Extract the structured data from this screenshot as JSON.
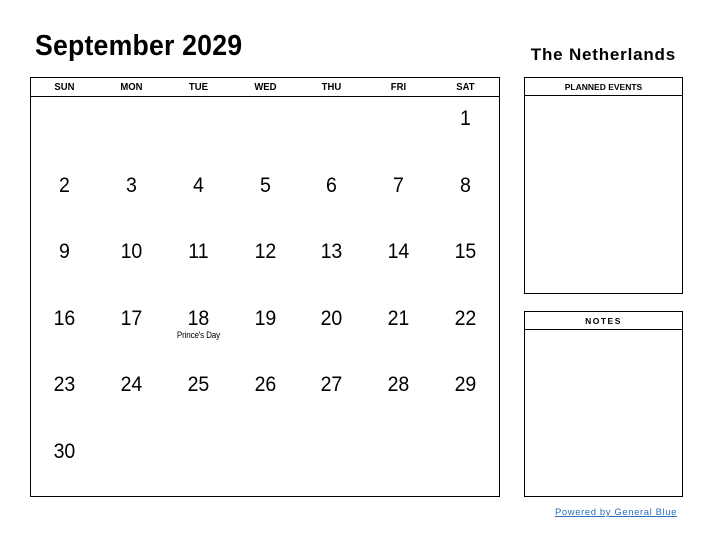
{
  "header": {
    "title": "September 2029",
    "country": "The Netherlands"
  },
  "calendar": {
    "weekdays": [
      "SUN",
      "MON",
      "TUE",
      "WED",
      "THU",
      "FRI",
      "SAT"
    ],
    "weeks": [
      [
        {
          "day": ""
        },
        {
          "day": ""
        },
        {
          "day": ""
        },
        {
          "day": ""
        },
        {
          "day": ""
        },
        {
          "day": ""
        },
        {
          "day": "1"
        }
      ],
      [
        {
          "day": "2"
        },
        {
          "day": "3"
        },
        {
          "day": "4"
        },
        {
          "day": "5"
        },
        {
          "day": "6"
        },
        {
          "day": "7"
        },
        {
          "day": "8"
        }
      ],
      [
        {
          "day": "9"
        },
        {
          "day": "10"
        },
        {
          "day": "11"
        },
        {
          "day": "12"
        },
        {
          "day": "13"
        },
        {
          "day": "14"
        },
        {
          "day": "15"
        }
      ],
      [
        {
          "day": "16"
        },
        {
          "day": "17"
        },
        {
          "day": "18",
          "event": "Prince's Day"
        },
        {
          "day": "19"
        },
        {
          "day": "20"
        },
        {
          "day": "21"
        },
        {
          "day": "22"
        }
      ],
      [
        {
          "day": "23"
        },
        {
          "day": "24"
        },
        {
          "day": "25"
        },
        {
          "day": "26"
        },
        {
          "day": "27"
        },
        {
          "day": "28"
        },
        {
          "day": "29"
        }
      ],
      [
        {
          "day": "30"
        },
        {
          "day": ""
        },
        {
          "day": ""
        },
        {
          "day": ""
        },
        {
          "day": ""
        },
        {
          "day": ""
        },
        {
          "day": ""
        }
      ]
    ]
  },
  "sidebar": {
    "planned_events_label": "PLANNED EVENTS",
    "notes_label": "NOTES"
  },
  "footer": {
    "powered_by": "Powered by General Blue",
    "link_color": "#2a6ebb"
  }
}
